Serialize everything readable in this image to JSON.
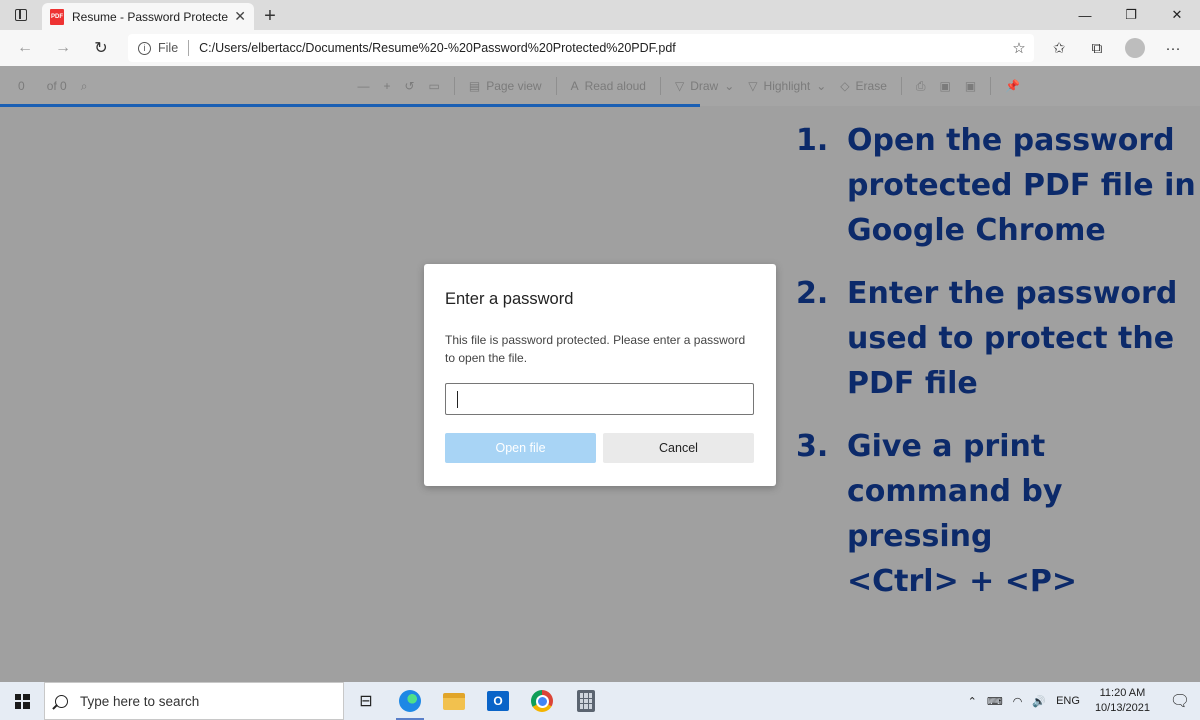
{
  "browser": {
    "tab_title": "Resume - Password Protected PDF",
    "pdf_badge": "PDF",
    "address": {
      "scheme_label": "File",
      "url": "C:/Users/elbertacc/Documents/Resume%20-%20Password%20Protected%20PDF.pdf"
    }
  },
  "pdf_toolbar": {
    "page_number": "0",
    "page_of": "of 0",
    "page_view": "Page view",
    "read_aloud": "Read aloud",
    "draw": "Draw",
    "highlight": "Highlight",
    "erase": "Erase"
  },
  "dialog": {
    "title": "Enter a password",
    "message": "This file is password protected. Please enter a password to open the file.",
    "password_value": "",
    "open_label": "Open file",
    "cancel_label": "Cancel"
  },
  "steps": [
    {
      "num": "1.",
      "text": "Open the password protected PDF file in Google Chrome"
    },
    {
      "num": "2.",
      "text": "Enter the password used to protect the PDF file"
    },
    {
      "num": "3.",
      "text": "Give a print command by pressing <Ctrl> + <P>"
    }
  ],
  "taskbar": {
    "search_placeholder": "Type here to search",
    "language": "ENG",
    "time": "11:20 AM",
    "date": "10/13/2021",
    "outlook_letter": "O"
  },
  "colors": {
    "steps_text": "#0c2a6a",
    "primary_button": "#a8d4f5",
    "progress": "#1a5fb4"
  }
}
